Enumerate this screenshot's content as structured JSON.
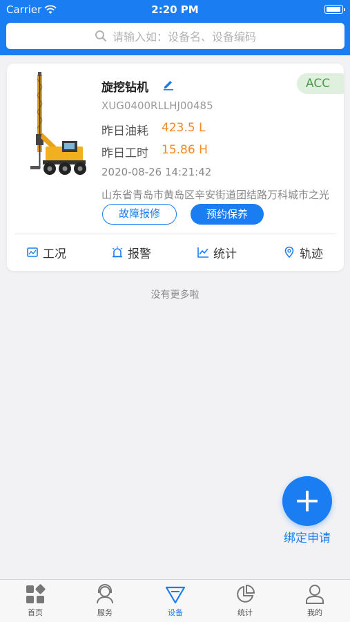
{
  "status_bar": {
    "carrier": "Carrier",
    "time": "2:20 PM"
  },
  "search": {
    "placeholder": "请输入如：设备名、设备编码"
  },
  "device": {
    "name": "旋挖钻机",
    "badge": "ACC",
    "serial": "XUG0400RLLHJ00485",
    "fuel_label": "昨日油耗",
    "fuel_value": "423.5 L",
    "hours_label": "昨日工时",
    "hours_value": "15.86 H",
    "datetime": "2020-08-26 14:21:42",
    "address": "山东省青岛市黄岛区辛安街道团结路万科城市之光",
    "fault_button": "故障报修",
    "maintenance_button": "预约保养",
    "actions": {
      "condition": "工况",
      "alarm": "报警",
      "stats": "统计",
      "track": "轨迹"
    }
  },
  "list_end_text": "没有更多啦",
  "fab_label": "绑定申请",
  "tabs": {
    "home": "首页",
    "service": "服务",
    "device": "设备",
    "stats": "统计",
    "mine": "我的"
  },
  "colors": {
    "primary": "#1a7ef2",
    "accent_orange": "#f08a24",
    "badge_green": "#4a9a4a"
  }
}
